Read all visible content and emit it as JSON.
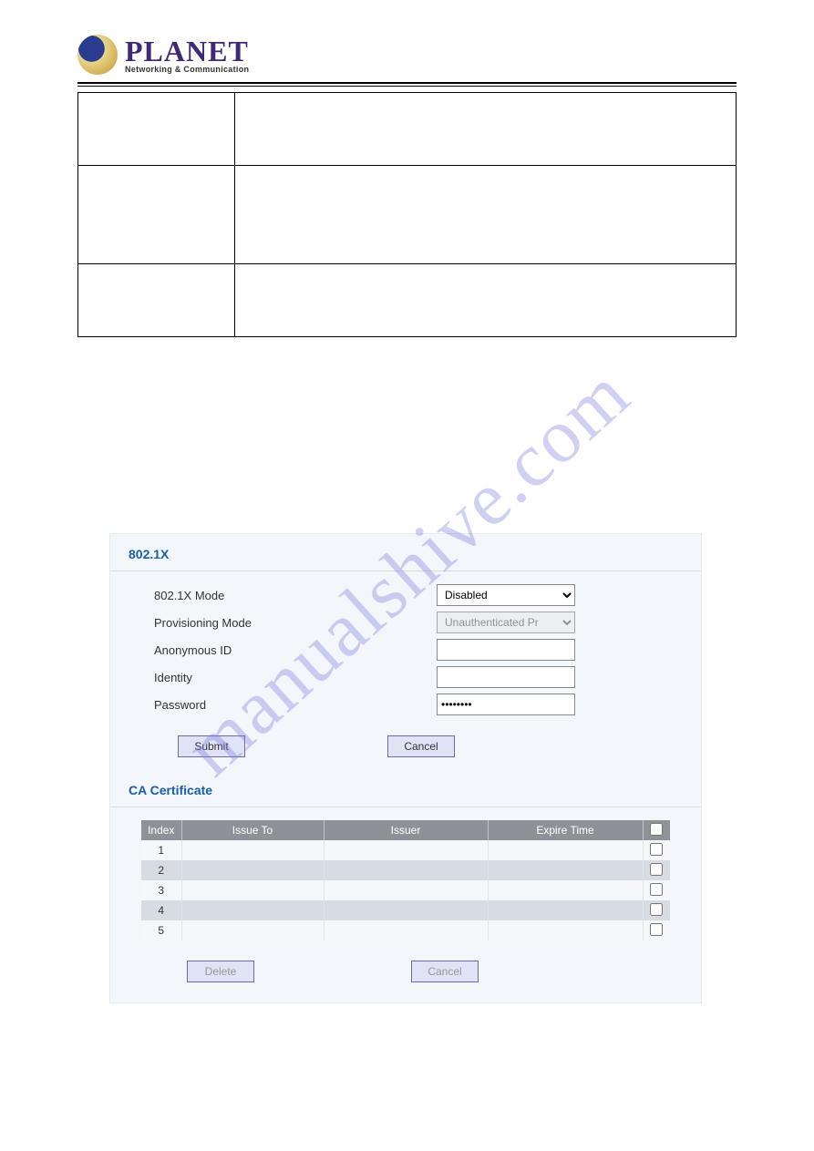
{
  "logo": {
    "title": "PLANET",
    "subtitle": "Networking & Communication"
  },
  "watermark": "manualshive.com",
  "panel": {
    "section1_title": "802.1X",
    "mode_label": "802.1X Mode",
    "mode_value": "Disabled",
    "provisioning_label": "Provisioning Mode",
    "provisioning_value": "Unauthenticated Pr",
    "anon_label": "Anonymous ID",
    "anon_value": "",
    "identity_label": "Identity",
    "identity_value": "",
    "password_label": "Password",
    "password_value": "••••••••",
    "submit": "Submit",
    "cancel": "Cancel",
    "section2_title": "CA Certificate",
    "cert_headers": {
      "index": "Index",
      "issue_to": "Issue To",
      "issuer": "Issuer",
      "expire": "Expire Time"
    },
    "cert_rows": [
      "1",
      "2",
      "3",
      "4",
      "5"
    ],
    "delete": "Delete",
    "cancel2": "Cancel"
  }
}
